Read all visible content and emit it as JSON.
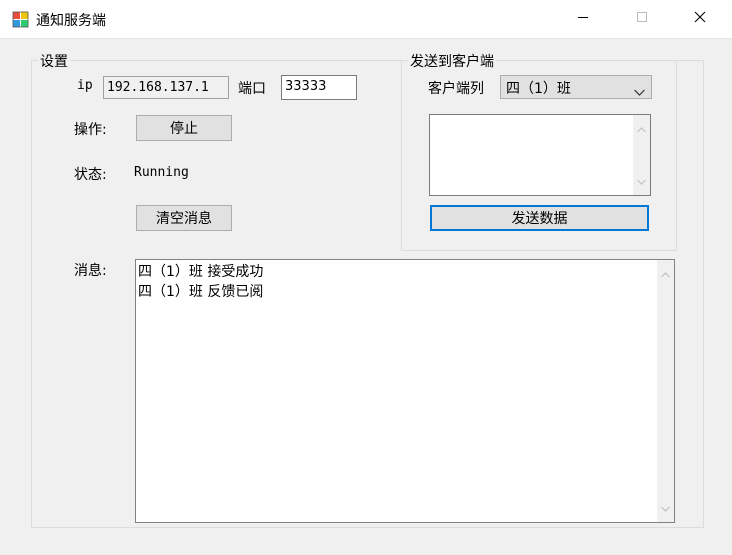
{
  "window": {
    "title": "通知服务端",
    "minimize_glyph": "—",
    "maximize_glyph": "☐",
    "close_glyph": "✕"
  },
  "settings": {
    "group_label": "设置",
    "ip_label": "ip",
    "ip_value": "192.168.137.1",
    "port_label": "端口",
    "port_value": "33333",
    "operation_label": "操作:",
    "stop_button": "停止",
    "status_label": "状态:",
    "status_value": "Running",
    "clear_button": "清空消息",
    "messages_label": "消息:"
  },
  "send": {
    "group_label": "发送到客户端",
    "client_list_label": "客户端列",
    "client_selected": "四（1）班",
    "message_text": "",
    "send_button": "发送数据"
  },
  "messages": [
    "四（1）班 接受成功",
    "四（1）班 反馈已阅"
  ]
}
